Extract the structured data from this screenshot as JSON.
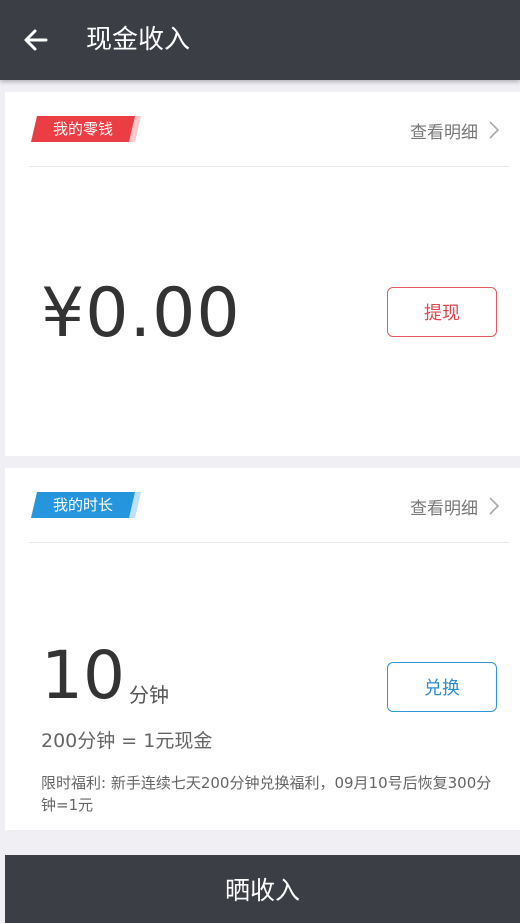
{
  "header": {
    "title": "现金收入",
    "back_icon": "arrow-left-icon"
  },
  "cash_card": {
    "tag_label": "我的零钱",
    "tag_color": "#ea3e44",
    "detail_label": "查看明细",
    "amount": "¥0.00",
    "withdraw_label": "提现"
  },
  "time_card": {
    "tag_label": "我的时长",
    "tag_color": "#2596dd",
    "detail_label": "查看明细",
    "minutes_value": "10",
    "minutes_unit": "分钟",
    "exchange_label": "兑换",
    "rate_text": "200分钟 = 1元现金",
    "notice_text": "限时福利: 新手连续七天200分钟兑换福利，09月10号后恢复300分钟=1元"
  },
  "footer": {
    "share_label": "晒收入"
  },
  "colors": {
    "topbar": "#3b3e45",
    "background": "#efeff4",
    "red_accent": "#e0474d",
    "blue_accent": "#2b8fd0"
  }
}
